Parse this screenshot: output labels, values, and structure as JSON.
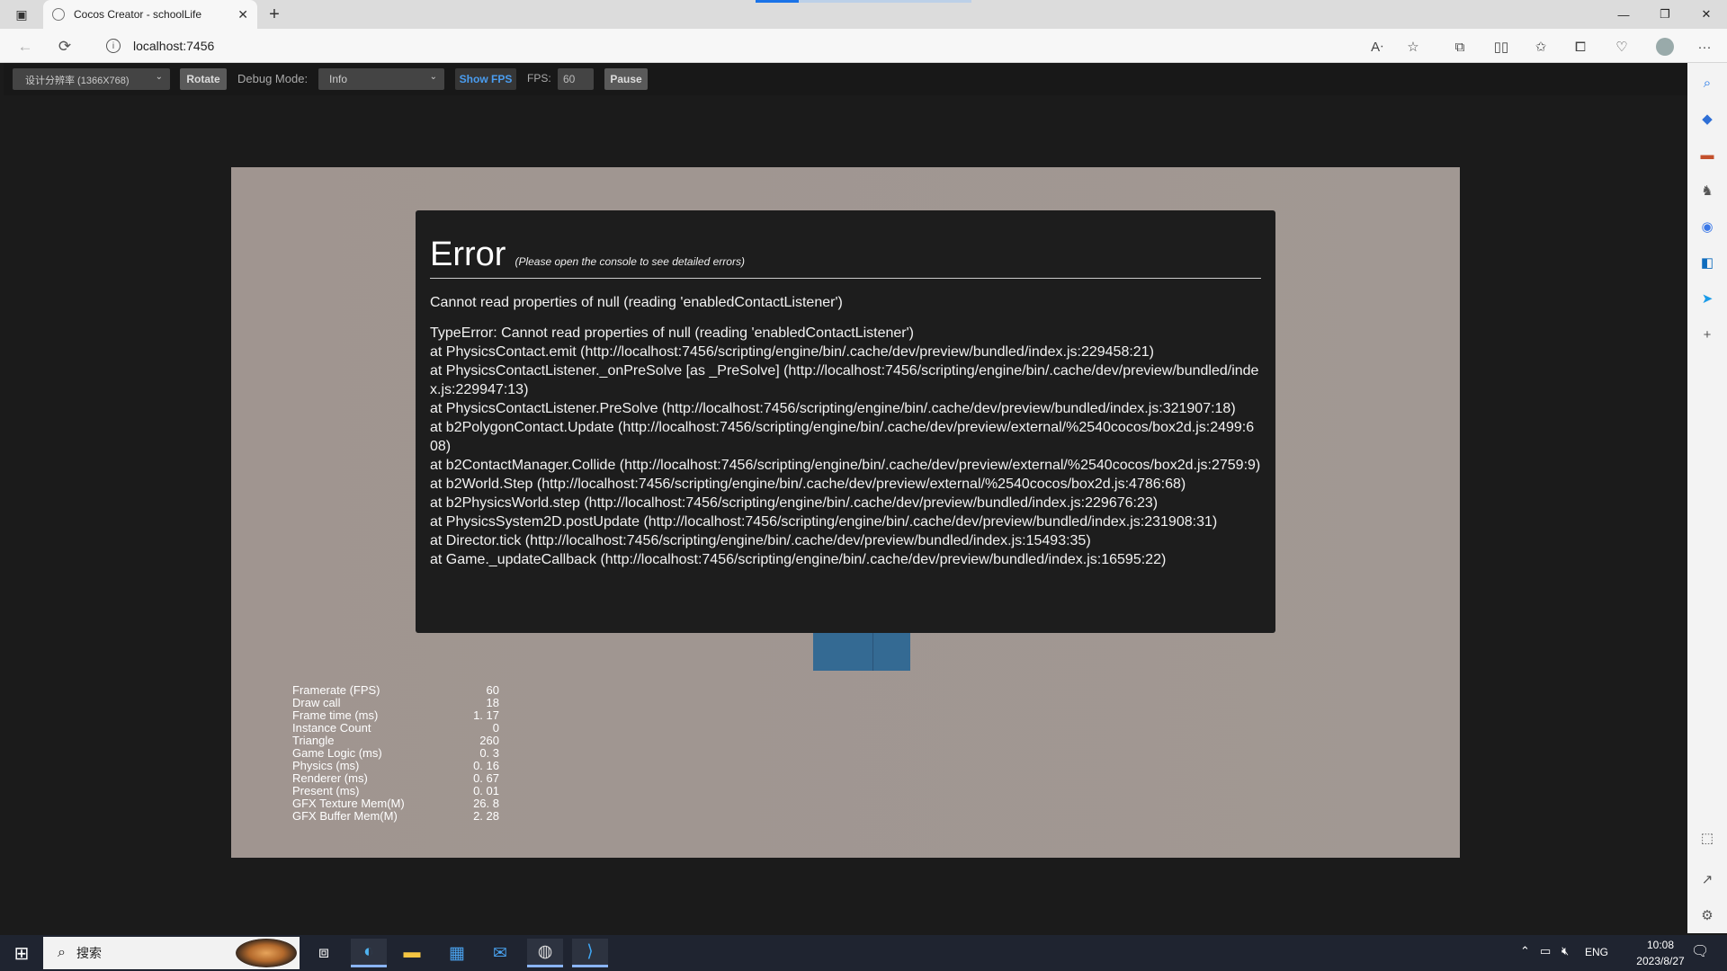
{
  "browser": {
    "tab_title": "Cocos Creator - schoolLife",
    "url": "localhost:7456"
  },
  "toolbar": {
    "resolution": "设计分辨率 (1366X768)",
    "rotate_label": "Rotate",
    "debug_mode_label": "Debug Mode:",
    "debug_mode_value": "Info",
    "show_fps_label": "Show FPS",
    "fps_label": "FPS:",
    "fps_value": "60",
    "pause_label": "Pause"
  },
  "error": {
    "title": "Error",
    "hint": "(Please open the console to see detailed errors)",
    "message": "Cannot read properties of null (reading 'enabledContactListener')",
    "stack": "TypeError: Cannot read properties of null (reading 'enabledContactListener')\nat PhysicsContact.emit (http://localhost:7456/scripting/engine/bin/.cache/dev/preview/bundled/index.js:229458:21)\nat PhysicsContactListener._onPreSolve [as _PreSolve] (http://localhost:7456/scripting/engine/bin/.cache/dev/preview/bundled/index.js:229947:13)\nat PhysicsContactListener.PreSolve (http://localhost:7456/scripting/engine/bin/.cache/dev/preview/bundled/index.js:321907:18)\nat b2PolygonContact.Update (http://localhost:7456/scripting/engine/bin/.cache/dev/preview/external/%2540cocos/box2d.js:2499:608)\nat b2ContactManager.Collide (http://localhost:7456/scripting/engine/bin/.cache/dev/preview/external/%2540cocos/box2d.js:2759:9)\nat b2World.Step (http://localhost:7456/scripting/engine/bin/.cache/dev/preview/external/%2540cocos/box2d.js:4786:68)\nat b2PhysicsWorld.step (http://localhost:7456/scripting/engine/bin/.cache/dev/preview/bundled/index.js:229676:23)\nat PhysicsSystem2D.postUpdate (http://localhost:7456/scripting/engine/bin/.cache/dev/preview/bundled/index.js:231908:31)\nat Director.tick (http://localhost:7456/scripting/engine/bin/.cache/dev/preview/bundled/index.js:15493:35)\nat Game._updateCallback (http://localhost:7456/scripting/engine/bin/.cache/dev/preview/bundled/index.js:16595:22)"
  },
  "stats": [
    {
      "k": "Framerate (FPS)",
      "v": "60"
    },
    {
      "k": "Draw call",
      "v": "18"
    },
    {
      "k": "Frame time (ms)",
      "v": "1. 17"
    },
    {
      "k": "Instance Count",
      "v": "0"
    },
    {
      "k": "Triangle",
      "v": "260"
    },
    {
      "k": "Game Logic (ms)",
      "v": "0. 3"
    },
    {
      "k": "Physics (ms)",
      "v": "0. 16"
    },
    {
      "k": "Renderer (ms)",
      "v": "0. 67"
    },
    {
      "k": "Present (ms)",
      "v": "0. 01"
    },
    {
      "k": "GFX Texture Mem(M)",
      "v": "26. 8"
    },
    {
      "k": "GFX Buffer Mem(M)",
      "v": "2. 28"
    }
  ],
  "taskbar": {
    "search_placeholder": "搜索",
    "lang": "ENG",
    "time": "10:08",
    "date": "2023/8/27"
  },
  "colors": {
    "canvas_bg": "#a09590",
    "error_bg": "#1d1d1d",
    "sprite": "#346a93",
    "show_fps_accent": "#4a9df0"
  }
}
